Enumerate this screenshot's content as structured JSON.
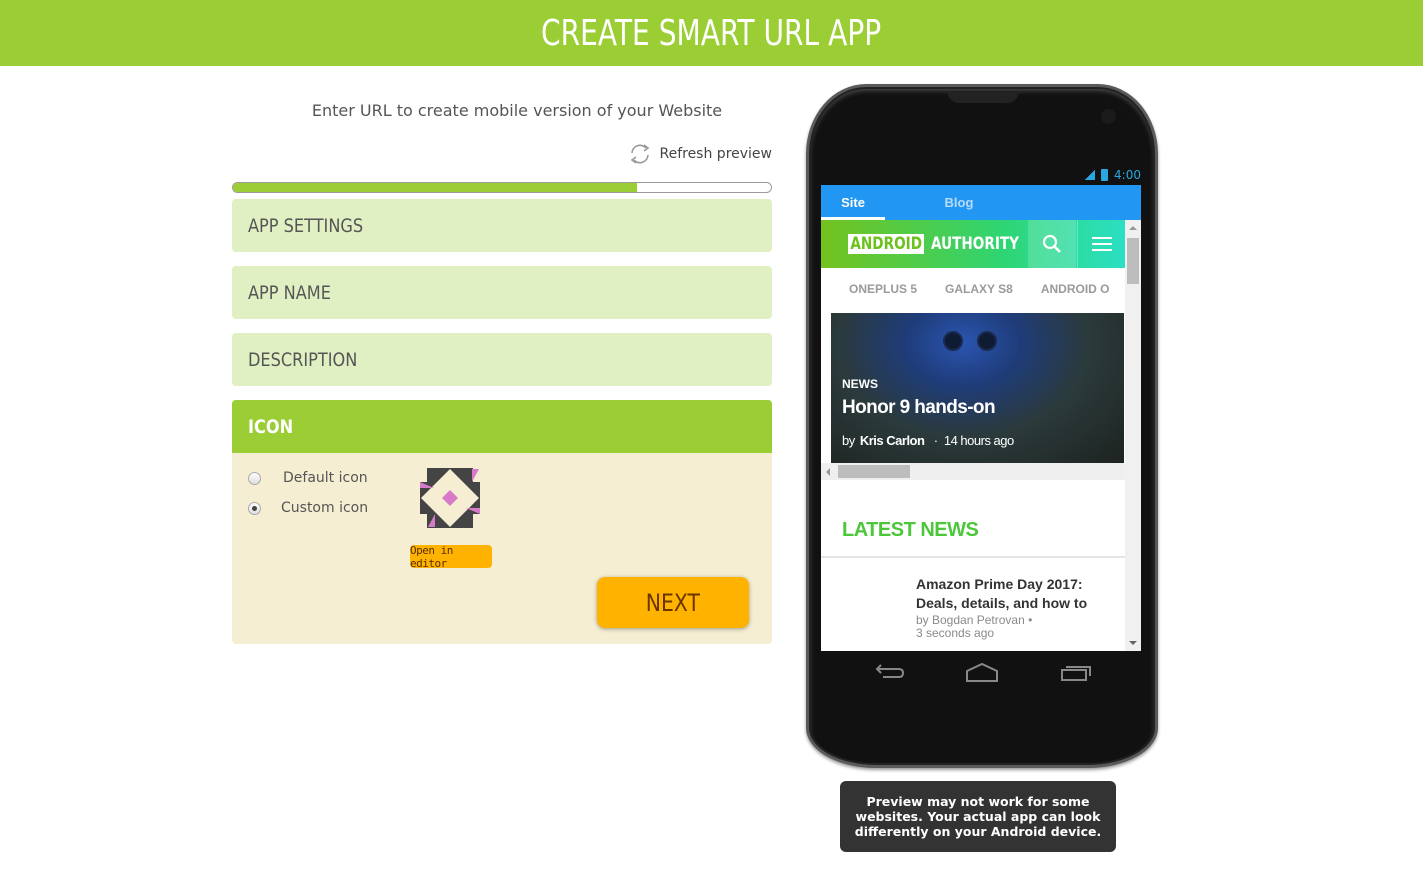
{
  "header": {
    "title": "CREATE SMART URL APP"
  },
  "form": {
    "subtitle": "Enter URL to create mobile version of your Website",
    "refresh_label": "Refresh preview",
    "progress_percent": 75,
    "sections": [
      {
        "label": "APP SETTINGS"
      },
      {
        "label": "APP NAME"
      },
      {
        "label": "DESCRIPTION"
      }
    ],
    "icon_section": {
      "label": "ICON",
      "options": [
        {
          "label": "Default icon",
          "checked": false
        },
        {
          "label": "Custom icon",
          "checked": true
        }
      ],
      "open_editor_label": "Open in editor"
    },
    "next_label": "NEXT"
  },
  "colors": {
    "brand_green": "#9bcd34",
    "section_bg": "#e1f0c3",
    "panel_bg": "#f5eed2",
    "button_orange": "#ffb300",
    "app_tab_blue": "#2196f3"
  },
  "phone": {
    "status_time": "4:00",
    "app_tabs": [
      {
        "label": "Site",
        "active": true
      },
      {
        "label": "Blog",
        "active": false
      }
    ],
    "website": {
      "logo_boxed": "ANDROID",
      "logo_plain": "AUTHORITY",
      "trending": [
        "ONEPLUS 5",
        "GALAXY S8",
        "ANDROID O"
      ],
      "hero": {
        "category": "NEWS",
        "title": "Honor 9 hands-on",
        "by": "by",
        "author": "Kris Carlon",
        "time": "14 hours ago"
      },
      "latest_heading": "LATEST NEWS",
      "latest_items": [
        {
          "headline": "Amazon Prime Day 2017: Deals, details, and how to",
          "byline": "by Bogdan Petrovan  •",
          "time": "3 seconds ago"
        }
      ]
    }
  },
  "disclaimer": "Preview may not work for some websites. Your actual app can look differently on your Android device."
}
